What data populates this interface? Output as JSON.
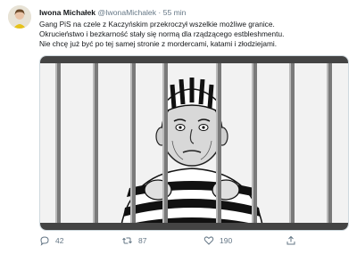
{
  "tweet": {
    "author_name": "Iwona Michałek",
    "handle": "@IwonaMichalek",
    "separator": "·",
    "time": "55 min",
    "text_lines": [
      "Gang PiS na czele z Kaczyńskim przekroczył wszelkie możliwe granice.",
      "Okrucieństwo i bezkarność stały się normą dla rządzącego estbleshmentu.",
      "Nie chcę już być po tej samej stronie z mordercami, katami i złodziejami."
    ],
    "media": {
      "description_icon": "prison-cartoon-image"
    },
    "actions": {
      "replies": "42",
      "retweets": "87",
      "likes": "190"
    }
  },
  "colors": {
    "text": "#14171a",
    "secondary": "#657786",
    "border": "#cfd9de"
  }
}
